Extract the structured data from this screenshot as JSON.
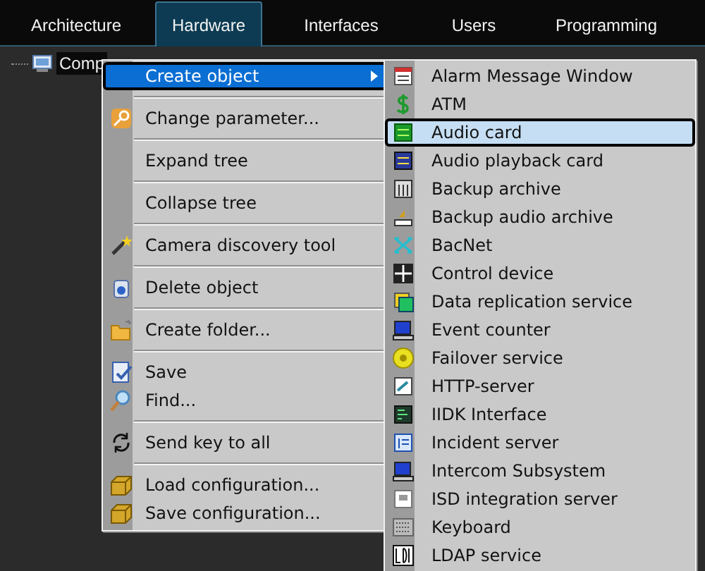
{
  "tabs": [
    {
      "label": "Architecture",
      "selected": false
    },
    {
      "label": "Hardware",
      "selected": true
    },
    {
      "label": "Interfaces",
      "selected": false
    },
    {
      "label": "Users",
      "selected": false
    },
    {
      "label": "Programming",
      "selected": false
    }
  ],
  "tree": {
    "items": [
      {
        "label": "Comp"
      }
    ]
  },
  "context_menu": {
    "items": [
      {
        "kind": "item",
        "label": "Create object",
        "selected": true,
        "submenu": true
      },
      {
        "kind": "separator"
      },
      {
        "kind": "item",
        "label": "Change parameter...",
        "selected": false
      },
      {
        "kind": "separator"
      },
      {
        "kind": "item",
        "label": "Expand tree",
        "selected": false
      },
      {
        "kind": "separator"
      },
      {
        "kind": "item",
        "label": "Collapse tree",
        "selected": false
      },
      {
        "kind": "separator"
      },
      {
        "kind": "item",
        "label": "Camera discovery tool",
        "selected": false
      },
      {
        "kind": "separator"
      },
      {
        "kind": "item",
        "label": "Delete object",
        "selected": false
      },
      {
        "kind": "separator"
      },
      {
        "kind": "item",
        "label": "Create folder...",
        "selected": false
      },
      {
        "kind": "separator"
      },
      {
        "kind": "item",
        "label": "Save",
        "selected": false
      },
      {
        "kind": "item",
        "label": "Find...",
        "selected": false
      },
      {
        "kind": "separator"
      },
      {
        "kind": "item",
        "label": "Send key to all",
        "selected": false
      },
      {
        "kind": "separator"
      },
      {
        "kind": "item",
        "label": "Load configuration...",
        "selected": false
      },
      {
        "kind": "item",
        "label": "Save configuration...",
        "selected": false
      }
    ]
  },
  "submenu": {
    "items": [
      {
        "label": "Alarm Message Window",
        "selected": false
      },
      {
        "label": "ATM",
        "selected": false
      },
      {
        "label": "Audio card",
        "selected": true
      },
      {
        "label": "Audio playback card",
        "selected": false
      },
      {
        "label": "Backup archive",
        "selected": false
      },
      {
        "label": "Backup audio archive",
        "selected": false
      },
      {
        "label": "BacNet",
        "selected": false
      },
      {
        "label": "Control device",
        "selected": false
      },
      {
        "label": "Data replication service",
        "selected": false
      },
      {
        "label": "Event counter",
        "selected": false
      },
      {
        "label": "Failover service",
        "selected": false
      },
      {
        "label": "HTTP-server",
        "selected": false
      },
      {
        "label": "IIDK Interface",
        "selected": false
      },
      {
        "label": "Incident server",
        "selected": false
      },
      {
        "label": "Intercom Subsystem",
        "selected": false
      },
      {
        "label": "ISD integration server",
        "selected": false
      },
      {
        "label": "Keyboard",
        "selected": false
      },
      {
        "label": "LDAP service",
        "selected": false
      }
    ]
  }
}
